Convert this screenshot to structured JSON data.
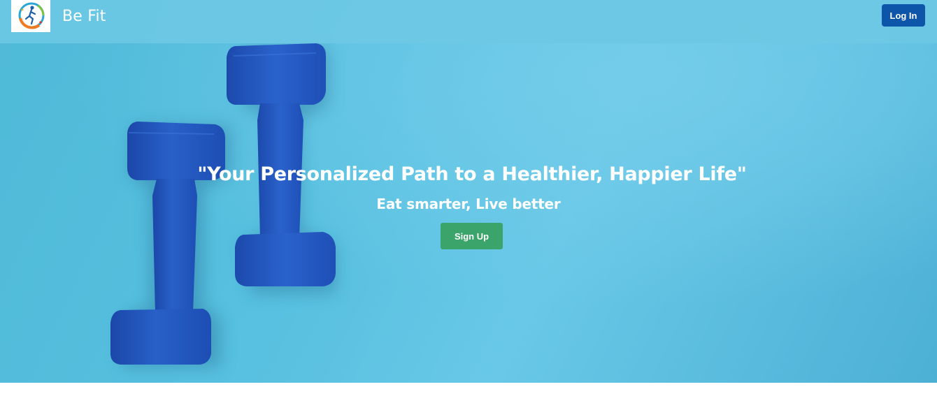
{
  "navbar": {
    "brand": "Be Fit",
    "logo_icon": "runner-logo-icon",
    "login_label": "Log In"
  },
  "hero": {
    "headline": "\"Your Personalized Path to a Healthier, Happier Life\"",
    "subheadline": "Eat smarter, Live better",
    "signup_label": "Sign Up",
    "background_image": "blue-dumbbells-photo"
  },
  "colors": {
    "hero_background": "#58c0e0",
    "navbar": "#6cc8e4",
    "login_button": "#0d55a8",
    "signup_button": "#3aa46b",
    "dumbbell": "#2257c0"
  }
}
